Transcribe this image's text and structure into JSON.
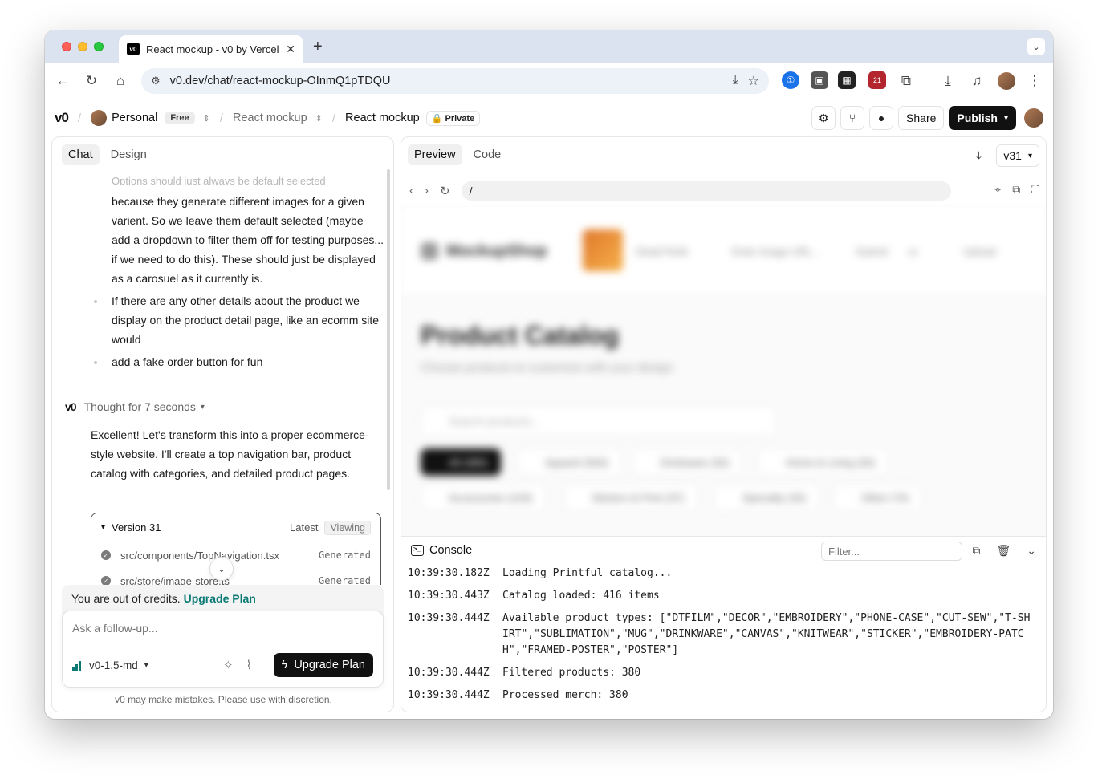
{
  "browser": {
    "tab_title": "React mockup - v0 by Vercel",
    "favicon": "v0",
    "url": "v0.dev/chat/react-mockup-OInmQ1pTDQU",
    "extension_badge": "21"
  },
  "app": {
    "logo": "v0",
    "workspace": "Personal",
    "plan_badge": "Free",
    "project": "React mockup",
    "chat_title": "React mockup",
    "visibility": "Private",
    "share_label": "Share",
    "publish_label": "Publish"
  },
  "chat": {
    "tabs": [
      {
        "label": "Chat",
        "active": true
      },
      {
        "label": "Design",
        "active": false
      }
    ],
    "faded_line": "Options should just always be default selected",
    "bullet_1": "because they generate different images for a given varient. So we leave them default selected (maybe add a dropdown to filter them off for testing purposes... if we need to do this). These should just be displayed as a carosuel as it currently is.",
    "bullet_2": "If there are any other details about the product we display on the product detail page, like an ecomm site would",
    "bullet_3": "add a fake order button for fun",
    "thought": "Thought for 7 seconds",
    "reply": "Excellent! Let's transform this into a proper ecommerce-style website. I'll create a top navigation bar, product catalog with categories, and detailed product pages.",
    "version": {
      "title": "Version 31",
      "latest": "Latest",
      "viewing": "Viewing",
      "files": [
        {
          "path": "src/components/TopNavigation.tsx",
          "status": "Generated"
        },
        {
          "path": "src/store/image-store.ts",
          "status": "Generated"
        }
      ]
    },
    "credits_text": "You are out of credits.",
    "credits_link": "Upgrade Plan",
    "composer_placeholder": "Ask a follow-up...",
    "model": "v0-1.5-md",
    "upgrade_button": "Upgrade Plan",
    "disclaimer": "v0 may make mistakes. Please use with discretion."
  },
  "preview": {
    "tabs": [
      {
        "label": "Preview",
        "active": true
      },
      {
        "label": "Code",
        "active": false
      }
    ],
    "version_select": "v31",
    "path": "/",
    "site": {
      "logo": "MockupShop",
      "nav_items": [
        "Detail Rolls",
        "Enter image URL...",
        "Submit",
        "or",
        "Upload"
      ],
      "heading": "Product Catalog",
      "subheading": "Choose products to customize with your design",
      "search_placeholder": "Search products...",
      "chips": [
        "All (380)",
        "Apparel (564)",
        "Drinkware (34)",
        "Home & Living (26)",
        "Accessories (103)",
        "Stickers & Print (37)",
        "Specialty (32)",
        "Other (74)"
      ]
    },
    "console": {
      "title": "Console",
      "filter_placeholder": "Filter...",
      "logs": [
        {
          "ts": "10:39:30.182Z",
          "msg": "Loading Printful catalog..."
        },
        {
          "ts": "10:39:30.443Z",
          "msg": "Catalog loaded: 416 items"
        },
        {
          "ts": "10:39:30.444Z",
          "msg": "Available product types: [\"DTFILM\",\"DECOR\",\"EMBROIDERY\",\"PHONE-CASE\",\"CUT-SEW\",\"T-SHIRT\",\"SUBLIMATION\",\"MUG\",\"DRINKWARE\",\"CANVAS\",\"KNITWEAR\",\"STICKER\",\"EMBROIDERY-PATCH\",\"FRAMED-POSTER\",\"POSTER\"]"
        },
        {
          "ts": "10:39:30.444Z",
          "msg": "Filtered products: 380"
        },
        {
          "ts": "10:39:30.444Z",
          "msg": "Processed merch: 380"
        }
      ]
    }
  },
  "colors": {
    "accent": "#0b7a75",
    "primary_button": "#111111",
    "tab_strip": "#dce3f0"
  }
}
